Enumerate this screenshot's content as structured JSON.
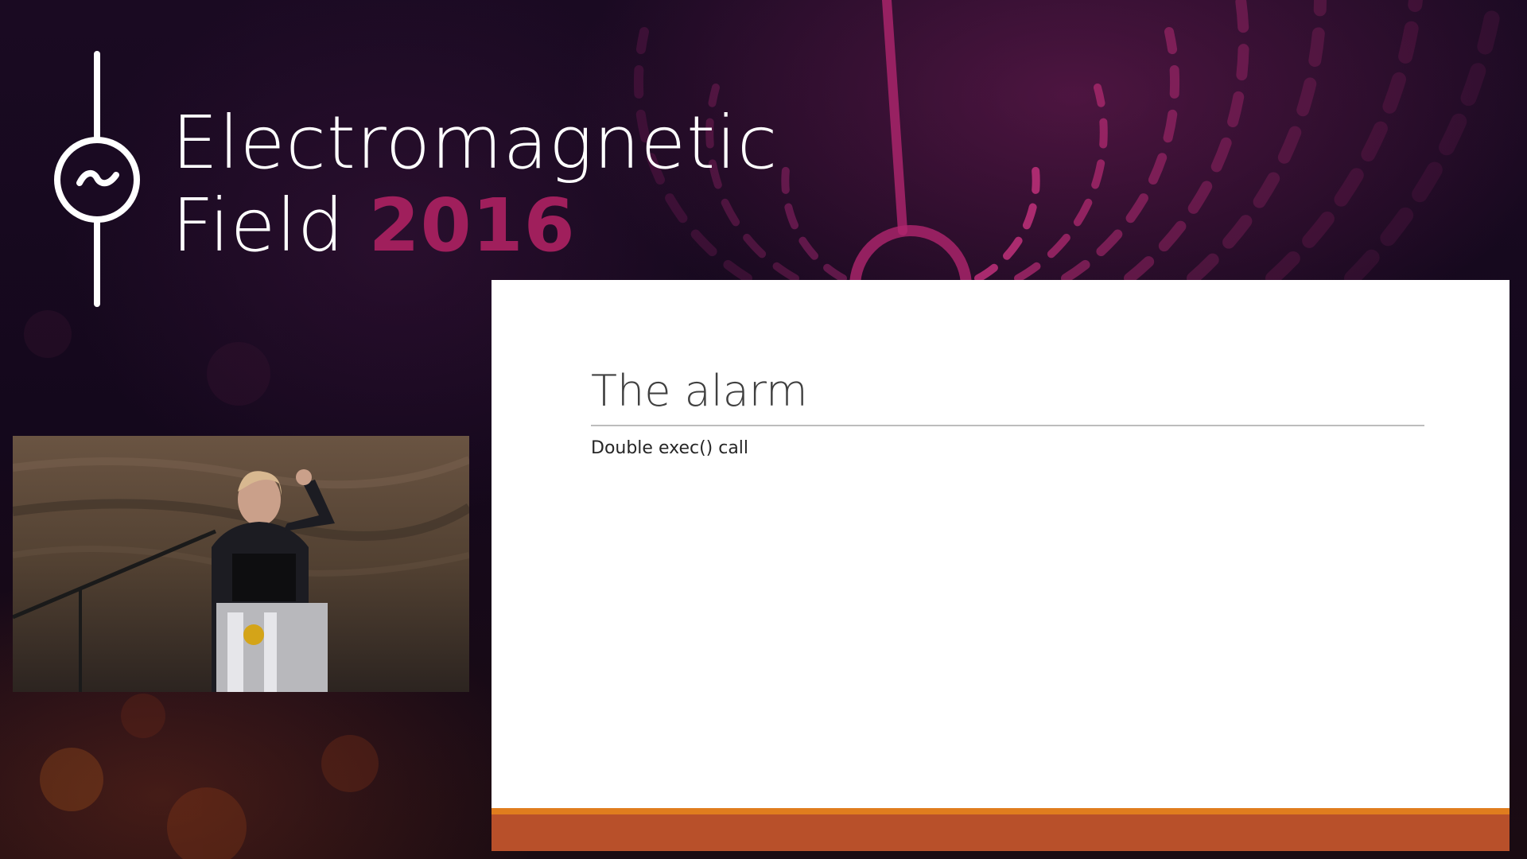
{
  "event": {
    "name_line1": "Electromagnetic",
    "name_line2": "Field",
    "year": "2016",
    "logo_icon": "tilde-in-circle-icon",
    "accent_color": "#a01f5c"
  },
  "speaker_video": {
    "icon": "speaker-camera-feed"
  },
  "slide": {
    "title": "The alarm",
    "bullet": "Double exec() call",
    "footer_colors": [
      "#e07d1e",
      "#b8502a"
    ]
  }
}
